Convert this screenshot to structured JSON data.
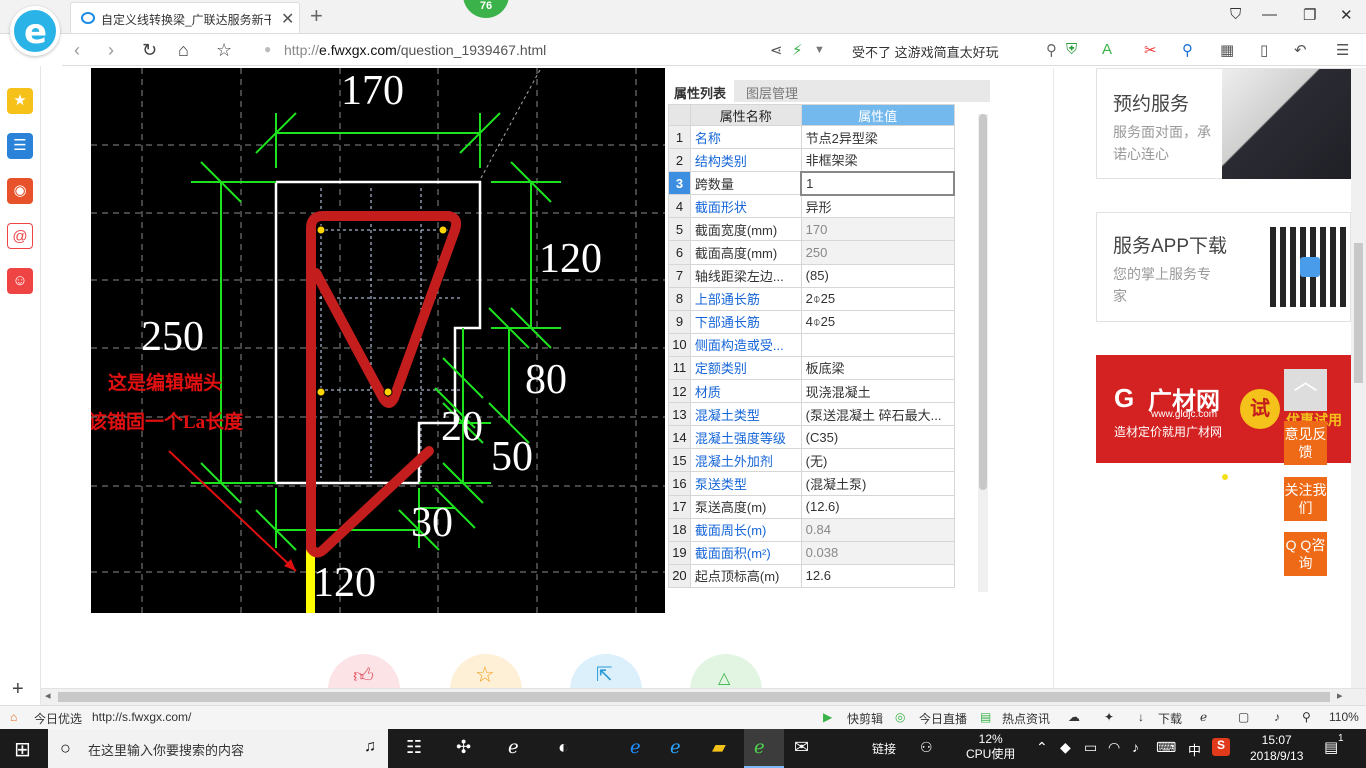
{
  "browser": {
    "tab_title": "自定义线转换梁_广联达服务新干",
    "tab_close": "✕",
    "new_tab": "+",
    "badge": "76",
    "url_prefix": "http://",
    "url_host": "e.fwxgx.com",
    "url_path": "/question_1939467.html",
    "search_hint": "受不了 这游戏简直太好玩",
    "zoom": "110%"
  },
  "cad": {
    "dims": {
      "top": "170",
      "right_upper": "120",
      "left": "250",
      "right_mid": "80",
      "step": "20",
      "right_low": "50",
      "bottom_mid": "30",
      "bottom": "120"
    },
    "annotation_line1": "这是编辑端头",
    "annotation_line2": "应该锚固一个La长度"
  },
  "props": {
    "tab_attr": "属性列表",
    "tab_layer": "图层管理",
    "col_name": "属性名称",
    "col_value": "属性值",
    "rows": [
      {
        "n": "1",
        "k": "名称",
        "v": "节点2异型梁"
      },
      {
        "n": "2",
        "k": "结构类别",
        "v": "非框架梁"
      },
      {
        "n": "3",
        "k": "跨数量",
        "v": "1"
      },
      {
        "n": "4",
        "k": "截面形状",
        "v": "异形"
      },
      {
        "n": "5",
        "k": "截面宽度(mm)",
        "v": "170"
      },
      {
        "n": "6",
        "k": "截面高度(mm)",
        "v": "250"
      },
      {
        "n": "7",
        "k": "轴线距梁左边...",
        "v": "(85)"
      },
      {
        "n": "8",
        "k": "上部通长筋",
        "v": "2⌽25"
      },
      {
        "n": "9",
        "k": "下部通长筋",
        "v": "4⌽25"
      },
      {
        "n": "10",
        "k": "侧面构造或受...",
        "v": ""
      },
      {
        "n": "11",
        "k": "定额类别",
        "v": "板底梁"
      },
      {
        "n": "12",
        "k": "材质",
        "v": "现浇混凝土"
      },
      {
        "n": "13",
        "k": "混凝土类型",
        "v": "(泵送混凝土 碎石最大..."
      },
      {
        "n": "14",
        "k": "混凝土强度等级",
        "v": "(C35)"
      },
      {
        "n": "15",
        "k": "混凝土外加剂",
        "v": "(无)"
      },
      {
        "n": "16",
        "k": "泵送类型",
        "v": "(混凝土泵)"
      },
      {
        "n": "17",
        "k": "泵送高度(m)",
        "v": "(12.6)"
      },
      {
        "n": "18",
        "k": "截面周长(m)",
        "v": "0.84"
      },
      {
        "n": "19",
        "k": "截面面积(m²)",
        "v": "0.038"
      },
      {
        "n": "20",
        "k": "起点顶标高(m)",
        "v": "12.6"
      }
    ]
  },
  "ads": {
    "booking_title": "预约服务",
    "booking_sub1": "服务面对面，承",
    "booking_sub2": "诺心连心",
    "app_title": "服务APP下载",
    "app_sub1": "您的掌上服务专",
    "app_sub2": "家",
    "gcw_name": "广材网",
    "gcw_site": "www.gldjc.com",
    "gcw_slogan": "造材定价就用广材网",
    "gcw_try": "试",
    "gcw_trial": "优惠试用",
    "feedback": "意见反馈",
    "follow": "关注我们",
    "qq": "Q Q咨询"
  },
  "statusbar": {
    "today": "今日优选",
    "link": "http://s.fwxgx.com/",
    "clip": "快剪辑",
    "live": "今日直播",
    "news": "热点资讯",
    "download": "下载",
    "zoom": "110%"
  },
  "taskbar": {
    "search_placeholder": "在这里输入你要搜索的内容",
    "links": "链接",
    "cpu_pct": "12%",
    "cpu_label": "CPU使用",
    "ime": "中",
    "time": "15:07",
    "date": "2018/9/13",
    "notif": "1"
  }
}
